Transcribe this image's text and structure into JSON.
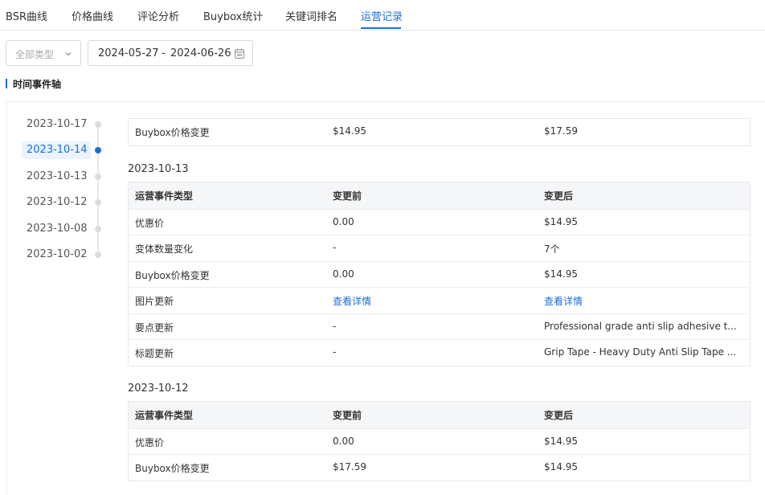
{
  "tabs": [
    {
      "label": "BSR曲线",
      "active": false
    },
    {
      "label": "价格曲线",
      "active": false
    },
    {
      "label": "评论分析",
      "active": false
    },
    {
      "label": "Buybox统计",
      "active": false
    },
    {
      "label": "关键词排名",
      "active": false
    },
    {
      "label": "运营记录",
      "active": true
    }
  ],
  "filters": {
    "type_select": "全部类型",
    "date_start": "2024-05-27",
    "date_separator": "-",
    "date_end": "2024-06-26"
  },
  "section_title": "时间事件轴",
  "timeline": [
    {
      "date": "2023-10-17",
      "active": false
    },
    {
      "date": "2023-10-14",
      "active": true
    },
    {
      "date": "2023-10-13",
      "active": false
    },
    {
      "date": "2023-10-12",
      "active": false
    },
    {
      "date": "2023-10-08",
      "active": false
    },
    {
      "date": "2023-10-02",
      "active": false
    }
  ],
  "columns": {
    "type": "运营事件类型",
    "before": "变更前",
    "after": "变更后"
  },
  "groups": [
    {
      "date": "",
      "rows": [
        {
          "type": "Buybox价格变更",
          "before": "$14.95",
          "after": "$17.59"
        }
      ]
    },
    {
      "date": "2023-10-13",
      "rows": [
        {
          "type": "优惠价",
          "before": "0.00",
          "after": "$14.95"
        },
        {
          "type": "变体数量变化",
          "before": "-",
          "after": "7个"
        },
        {
          "type": "Buybox价格变更",
          "before": "0.00",
          "after": "$14.95"
        },
        {
          "type": "图片更新",
          "before": "查看详情",
          "after": "查看详情",
          "link": true
        },
        {
          "type": "要点更新",
          "before": "-",
          "after": "Professional grade anti slip adhesive t..."
        },
        {
          "type": "标题更新",
          "before": "-",
          "after": "Grip Tape - Heavy Duty Anti Slip Tape ..."
        }
      ]
    },
    {
      "date": "2023-10-12",
      "rows": [
        {
          "type": "优惠价",
          "before": "0.00",
          "after": "$14.95"
        },
        {
          "type": "Buybox价格变更",
          "before": "$17.59",
          "after": "$14.95"
        }
      ]
    }
  ],
  "colors": {
    "accent": "#1a6fd8",
    "header_bg": "#f5f6f8",
    "border": "#e8e8e8"
  }
}
